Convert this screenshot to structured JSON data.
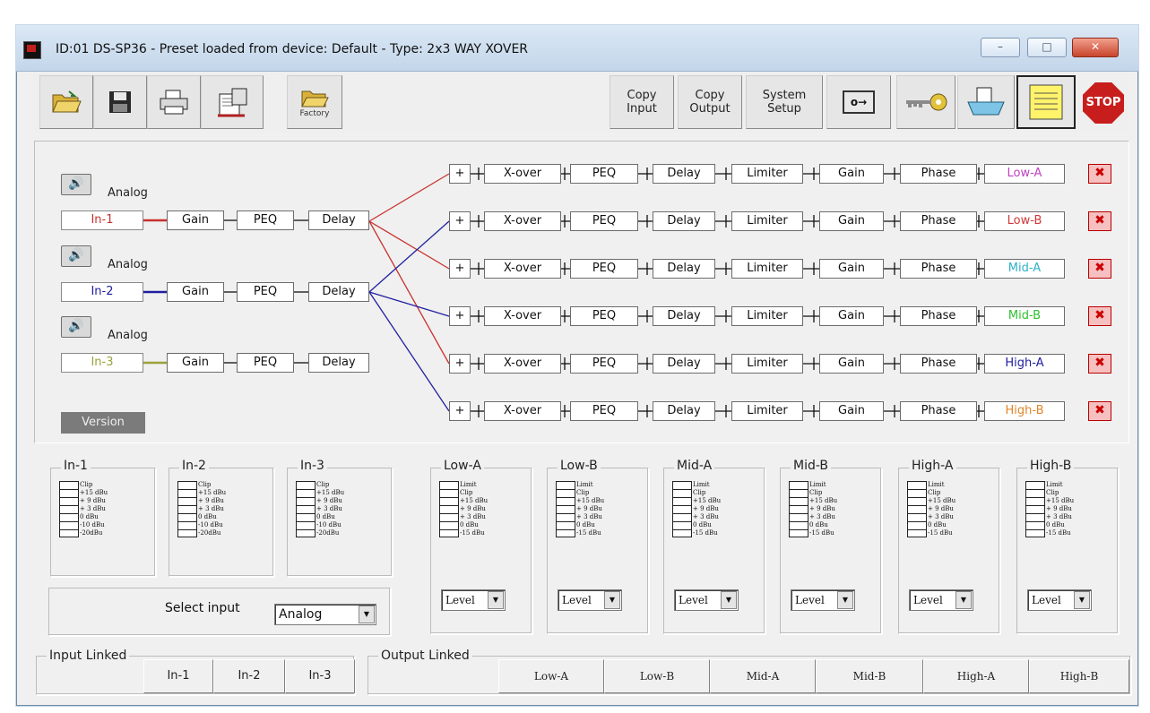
{
  "window": {
    "title": "ID:01 DS-SP36 - Preset loaded from device: Default - Type: 2x3 WAY XOVER",
    "minimize_label": "–",
    "maximize_label": "□",
    "close_label": "✕"
  },
  "toolbar": {
    "factory_label": "Factory",
    "copy_input": [
      "Copy",
      "Input"
    ],
    "copy_output": [
      "Copy",
      "Output"
    ],
    "system_setup": [
      "System",
      "Setup"
    ],
    "key_label": "o→",
    "stop_label": "STOP"
  },
  "inputs": [
    {
      "name": "In-1",
      "source": "Analog",
      "color": "#c9302c",
      "blocks": [
        "Gain",
        "PEQ",
        "Delay"
      ]
    },
    {
      "name": "In-2",
      "source": "Analog",
      "color": "#2020a0",
      "blocks": [
        "Gain",
        "PEQ",
        "Delay"
      ]
    },
    {
      "name": "In-3",
      "source": "Analog",
      "color": "#9aa23a",
      "blocks": [
        "Gain",
        "PEQ",
        "Delay"
      ]
    }
  ],
  "outputs": [
    {
      "name": "Low-A",
      "color": "#c040c0",
      "sum": "+",
      "blocks": [
        "X-over",
        "PEQ",
        "Delay",
        "Limiter",
        "Gain",
        "Phase"
      ]
    },
    {
      "name": "Low-B",
      "color": "#d03838",
      "sum": "+",
      "blocks": [
        "X-over",
        "PEQ",
        "Delay",
        "Limiter",
        "Gain",
        "Phase"
      ]
    },
    {
      "name": "Mid-A",
      "color": "#2fb0c8",
      "sum": "+",
      "blocks": [
        "X-over",
        "PEQ",
        "Delay",
        "Limiter",
        "Gain",
        "Phase"
      ]
    },
    {
      "name": "Mid-B",
      "color": "#30c030",
      "sum": "+",
      "blocks": [
        "X-over",
        "PEQ",
        "Delay",
        "Limiter",
        "Gain",
        "Phase"
      ]
    },
    {
      "name": "High-A",
      "color": "#2020a0",
      "sum": "+",
      "blocks": [
        "X-over",
        "PEQ",
        "Delay",
        "Limiter",
        "Gain",
        "Phase"
      ]
    },
    {
      "name": "High-B",
      "color": "#e0862a",
      "sum": "+",
      "blocks": [
        "X-over",
        "PEQ",
        "Delay",
        "Limiter",
        "Gain",
        "Phase"
      ]
    }
  ],
  "version_label": "Version",
  "input_meters": {
    "groups": [
      "In-1",
      "In-2",
      "In-3"
    ],
    "scale": [
      "Clip",
      "+15 dBu",
      "+ 9 dBu",
      "+ 3 dBu",
      "0 dBu",
      "-10 dBu",
      "-20dBu"
    ]
  },
  "output_meters": {
    "groups": [
      "Low-A",
      "Low-B",
      "Mid-A",
      "Mid-B",
      "High-A",
      "High-B"
    ],
    "scale": [
      "Limit",
      "Clip",
      "+15 dBu",
      "+ 9 dBu",
      "+ 3 dBu",
      "0 dBu",
      "-15 dBu"
    ],
    "mode_value": "Level"
  },
  "select_input": {
    "label": "Select input",
    "value": "Analog"
  },
  "input_linked": {
    "label": "Input Linked",
    "buttons": [
      "In-1",
      "In-2",
      "In-3"
    ]
  },
  "output_linked": {
    "label": "Output Linked",
    "buttons": [
      "Low-A",
      "Low-B",
      "Mid-A",
      "Mid-B",
      "High-A",
      "High-B"
    ]
  }
}
